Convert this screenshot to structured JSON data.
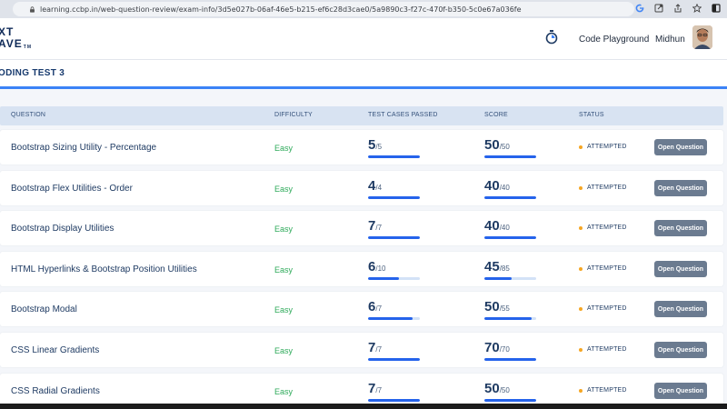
{
  "browser": {
    "url": "learning.ccbp.in/web-question-review/exam-info/3d5e027b-06af-46e5-b215-ef6c28d3cae0/5a9890c3-f27c-470f-b350-5c0e67a036fe",
    "icons": [
      "google-icon",
      "open-in-app-icon",
      "share-icon",
      "star-icon",
      "side-panel-icon"
    ]
  },
  "header": {
    "logo_line1": "XT",
    "logo_line2": "AVE",
    "logo_tm": "TM",
    "code_playground": "Code Playground",
    "user_name": "Midhun"
  },
  "page": {
    "title": "ODING TEST 3"
  },
  "table": {
    "headers": {
      "question": "QUESTION",
      "difficulty": "DIFFICULTY",
      "test_cases": "TEST CASES PASSED",
      "score": "SCORE",
      "status": "STATUS"
    },
    "rows": [
      {
        "question": "Bootstrap Sizing Utility - Percentage",
        "difficulty": "Easy",
        "tc_passed": "5",
        "tc_total": "/5",
        "score": "50",
        "score_total": "/50",
        "status": "ATTEMPTED",
        "action": "Open Question",
        "tc_fraction": 1.0,
        "score_fraction": 1.0
      },
      {
        "question": "Bootstrap Flex Utilities - Order",
        "difficulty": "Easy",
        "tc_passed": "4",
        "tc_total": "/4",
        "score": "40",
        "score_total": "/40",
        "status": "ATTEMPTED",
        "action": "Open Question",
        "tc_fraction": 1.0,
        "score_fraction": 1.0
      },
      {
        "question": "Bootstrap Display Utilities",
        "difficulty": "Easy",
        "tc_passed": "7",
        "tc_total": "/7",
        "score": "40",
        "score_total": "/40",
        "status": "ATTEMPTED",
        "action": "Open Question",
        "tc_fraction": 1.0,
        "score_fraction": 1.0
      },
      {
        "question": "HTML Hyperlinks & Bootstrap Position Utilities",
        "difficulty": "Easy",
        "tc_passed": "6",
        "tc_total": "/10",
        "score": "45",
        "score_total": "/85",
        "status": "ATTEMPTED",
        "action": "Open Question",
        "tc_fraction": 0.6,
        "score_fraction": 0.53
      },
      {
        "question": "Bootstrap Modal",
        "difficulty": "Easy",
        "tc_passed": "6",
        "tc_total": "/7",
        "score": "50",
        "score_total": "/55",
        "status": "ATTEMPTED",
        "action": "Open Question",
        "tc_fraction": 0.857,
        "score_fraction": 0.909
      },
      {
        "question": "CSS Linear Gradients",
        "difficulty": "Easy",
        "tc_passed": "7",
        "tc_total": "/7",
        "score": "70",
        "score_total": "/70",
        "status": "ATTEMPTED",
        "action": "Open Question",
        "tc_fraction": 1.0,
        "score_fraction": 1.0
      },
      {
        "question": "CSS Radial Gradients",
        "difficulty": "Easy",
        "tc_passed": "7",
        "tc_total": "/7",
        "score": "50",
        "score_total": "/50",
        "status": "ATTEMPTED",
        "action": "Open Question",
        "tc_fraction": 1.0,
        "score_fraction": 1.0
      }
    ]
  },
  "colors": {
    "accent": "#3b82f6",
    "progress": "#2563eb",
    "easy": "#2eaa5a",
    "attempted_dot": "#f5a623",
    "button": "#6b7b90"
  }
}
